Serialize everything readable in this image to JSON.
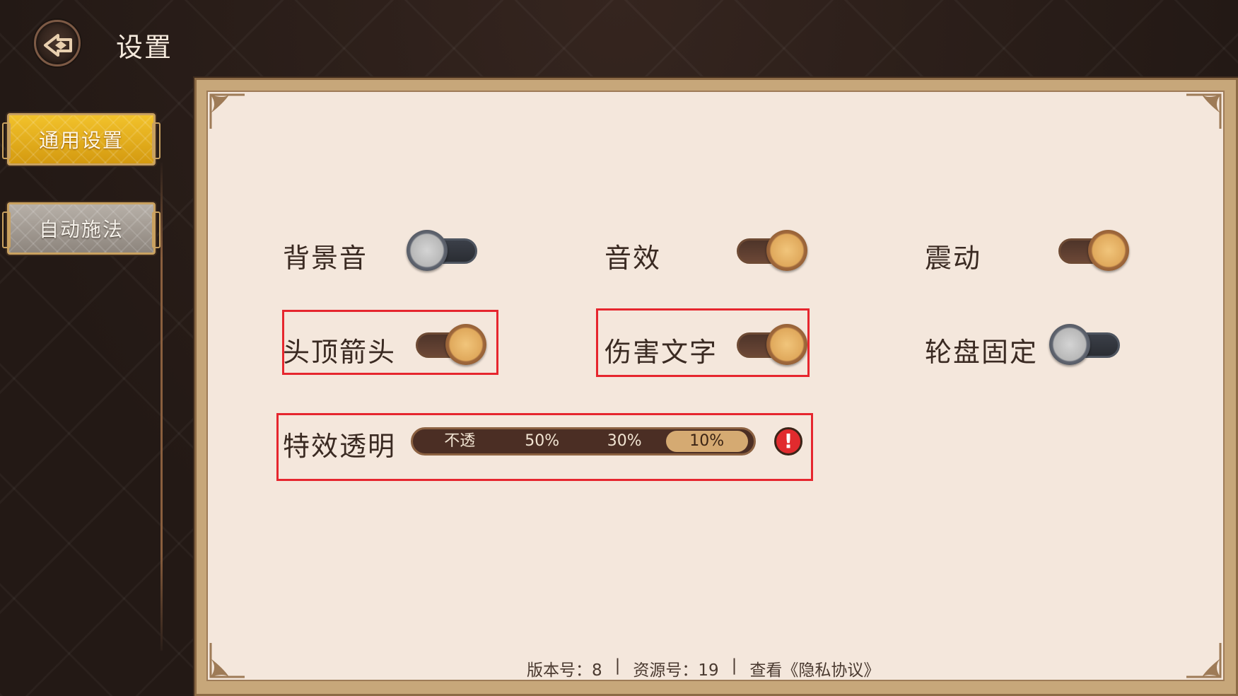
{
  "header": {
    "title": "设置"
  },
  "sidebar": {
    "tabs": [
      {
        "label": "通用设置",
        "active": true
      },
      {
        "label": "自动施法",
        "active": false
      }
    ]
  },
  "settings": {
    "bgm": {
      "label": "背景音",
      "on": false
    },
    "sfx": {
      "label": "音效",
      "on": true
    },
    "vibration": {
      "label": "震动",
      "on": true
    },
    "head_arrow": {
      "label": "头顶箭头",
      "on": true
    },
    "damage_text": {
      "label": "伤害文字",
      "on": true
    },
    "joystick_fixed": {
      "label": "轮盘固定",
      "on": false
    },
    "effect_transparency": {
      "label": "特效透明",
      "options": [
        "不透",
        "50%",
        "30%",
        "10%"
      ],
      "selected": "10%"
    }
  },
  "info_icon": "exclamation-icon",
  "footer": {
    "version": "版本号：8",
    "resource": "资源号：19",
    "separator": "|",
    "privacy": "查看《隐私协议》"
  },
  "colors": {
    "highlight_box": "#e6262e",
    "active_tab": "#f2c22b",
    "panel_bg": "#f4e7dc"
  }
}
